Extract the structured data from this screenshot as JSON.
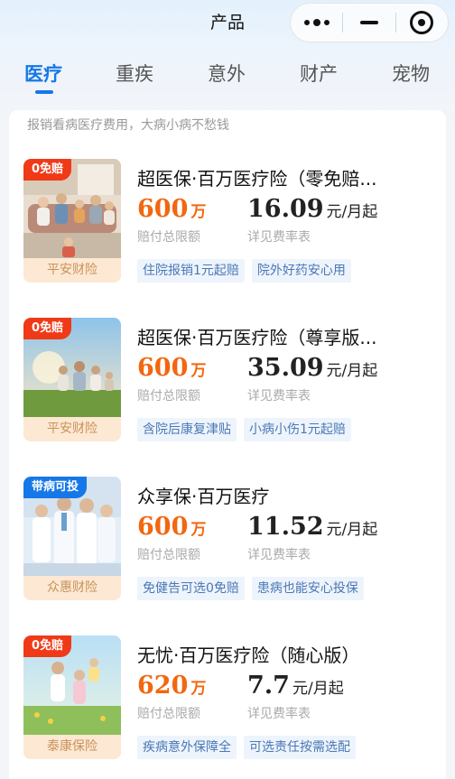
{
  "topbar": {
    "title": "产品"
  },
  "tabs": [
    {
      "label": "医疗",
      "active": true
    },
    {
      "label": "重疾",
      "active": false
    },
    {
      "label": "意外",
      "active": false
    },
    {
      "label": "财产",
      "active": false
    },
    {
      "label": "宠物",
      "active": false
    }
  ],
  "subtitle": "报销看病医疗费用，大病小病不愁钱",
  "products": [
    {
      "badge": "0免赔",
      "badge_color": "#f03a17",
      "insurer": "平安财险",
      "title": "超医保·百万医疗险（零免赔...",
      "amount": "600",
      "amount_unit": "万",
      "amount_label": "赔付总限额",
      "price": "16.09",
      "price_unit": "元/月起",
      "price_label": "详见费率表",
      "tags": [
        "住院报销1元起赔",
        "院外好药安心用"
      ],
      "image": "family-living-room"
    },
    {
      "badge": "0免赔",
      "badge_color": "#f03a17",
      "insurer": "平安财险",
      "title": "超医保·百万医疗险（尊享版...",
      "amount": "600",
      "amount_unit": "万",
      "amount_label": "赔付总限额",
      "price": "35.09",
      "price_unit": "元/月起",
      "price_label": "详见费率表",
      "tags": [
        "含院后康复津贴",
        "小病小伤1元起赔"
      ],
      "image": "family-on-grass"
    },
    {
      "badge": "带病可投",
      "badge_color": "#1677e8",
      "insurer": "众惠财险",
      "title": "众享保·百万医疗",
      "amount": "600",
      "amount_unit": "万",
      "amount_label": "赔付总限额",
      "price": "11.52",
      "price_unit": "元/月起",
      "price_label": "详见费率表",
      "tags": [
        "免健告可选0免赔",
        "患病也能安心投保"
      ],
      "image": "medical-staff"
    },
    {
      "badge": "0免赔",
      "badge_color": "#f03a17",
      "insurer": "泰康保险",
      "title": "无忧·百万医疗险（随心版）",
      "amount": "620",
      "amount_unit": "万",
      "amount_label": "赔付总限额",
      "price": "7.7",
      "price_unit": "元/月起",
      "price_label": "详见费率表",
      "tags": [
        "疾病意外保障全",
        "可选责任按需选配"
      ],
      "image": "family-outdoors"
    }
  ]
}
